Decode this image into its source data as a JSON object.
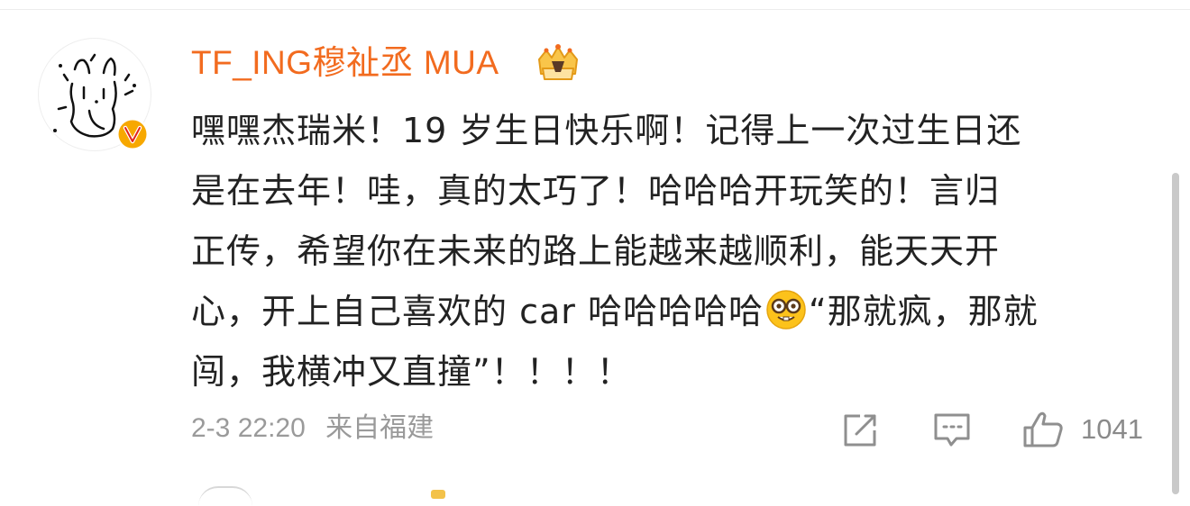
{
  "comment": {
    "username": "TF_ING穆祉丞 MUA",
    "body_lines": [
      "嘿嘿杰瑞米！19 岁生日快乐啊！记得上一次过生日还",
      "是在去年！哇，真的太巧了！哈哈哈开玩笑的！言归",
      "正传，希望你在未来的路上能越来越顺利，能天天开",
      "心，开上自己喜欢的 car 哈哈哈哈哈",
      "“那就疯，那就",
      "闯，我横冲又直撞”！！！！"
    ],
    "emoji": "nerd-face-emoji",
    "timestamp": "2-3 22:20",
    "location": "来自福建",
    "like_count": "1041"
  },
  "icons": {
    "share": "share-icon",
    "reply": "comment-icon",
    "like": "thumbs-up-icon",
    "verified": "verified-v-icon",
    "crown": "crown-badge-icon"
  },
  "colors": {
    "username": "#f26b1f",
    "verified_badge": "#f7a800",
    "body_text": "#222222",
    "meta_text": "#9a9a9a"
  }
}
